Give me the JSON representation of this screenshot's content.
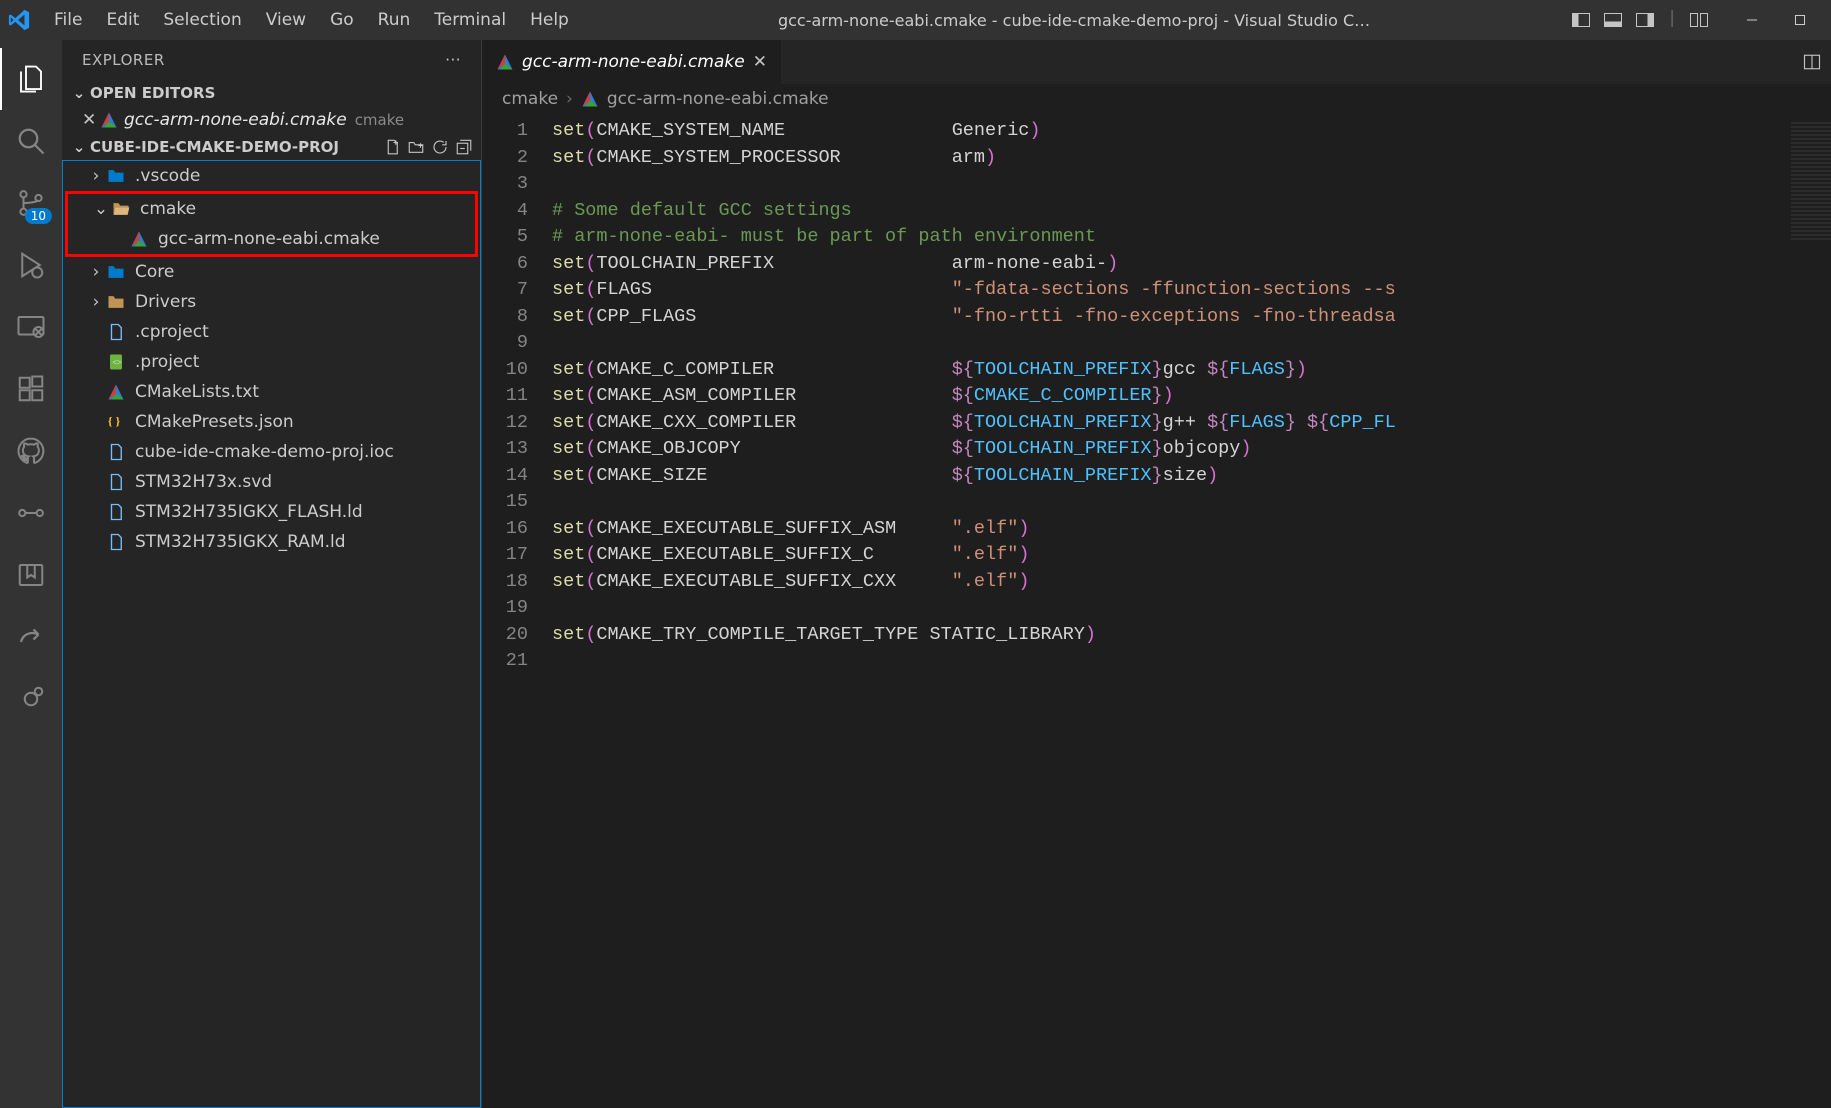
{
  "menu": [
    "File",
    "Edit",
    "Selection",
    "View",
    "Go",
    "Run",
    "Terminal",
    "Help"
  ],
  "window_title": "gcc-arm-none-eabi.cmake - cube-ide-cmake-demo-proj - Visual Studio C…",
  "activity_badge_source_control": "10",
  "explorer": {
    "title": "EXPLORER",
    "open_editors_label": "OPEN EDITORS",
    "open_editor": {
      "name": "gcc-arm-none-eabi.cmake",
      "dir": "cmake"
    },
    "project_label": "CUBE-IDE-CMAKE-DEMO-PROJ",
    "tree": [
      {
        "type": "folder",
        "name": ".vscode",
        "depth": 1,
        "expanded": false,
        "icon": "vscode"
      },
      {
        "type": "folder",
        "name": "cmake",
        "depth": 1,
        "expanded": true,
        "icon": "folder",
        "highlight": true
      },
      {
        "type": "file",
        "name": "gcc-arm-none-eabi.cmake",
        "depth": 2,
        "icon": "cmake",
        "highlight": true
      },
      {
        "type": "folder",
        "name": "Core",
        "depth": 1,
        "expanded": false,
        "icon": "vscode"
      },
      {
        "type": "folder",
        "name": "Drivers",
        "depth": 1,
        "expanded": false,
        "icon": "folder"
      },
      {
        "type": "file",
        "name": ".cproject",
        "depth": 1,
        "icon": "file"
      },
      {
        "type": "file",
        "name": ".project",
        "depth": 1,
        "icon": "xml"
      },
      {
        "type": "file",
        "name": "CMakeLists.txt",
        "depth": 1,
        "icon": "cmake"
      },
      {
        "type": "file",
        "name": "CMakePresets.json",
        "depth": 1,
        "icon": "json"
      },
      {
        "type": "file",
        "name": "cube-ide-cmake-demo-proj.ioc",
        "depth": 1,
        "icon": "file"
      },
      {
        "type": "file",
        "name": "STM32H73x.svd",
        "depth": 1,
        "icon": "file"
      },
      {
        "type": "file",
        "name": "STM32H735IGKX_FLASH.ld",
        "depth": 1,
        "icon": "file"
      },
      {
        "type": "file",
        "name": "STM32H735IGKX_RAM.ld",
        "depth": 1,
        "icon": "file"
      }
    ]
  },
  "tab": {
    "name": "gcc-arm-none-eabi.cmake"
  },
  "breadcrumb": {
    "part1": "cmake",
    "part2": "gcc-arm-none-eabi.cmake"
  },
  "code_lines": [
    [
      [
        "fn",
        "set"
      ],
      [
        "paren",
        "("
      ],
      [
        "id",
        "CMAKE_SYSTEM_NAME               "
      ],
      [
        "id",
        "Generic"
      ],
      [
        "paren",
        ")"
      ]
    ],
    [
      [
        "fn",
        "set"
      ],
      [
        "paren",
        "("
      ],
      [
        "id",
        "CMAKE_SYSTEM_PROCESSOR          "
      ],
      [
        "id",
        "arm"
      ],
      [
        "paren",
        ")"
      ]
    ],
    [],
    [
      [
        "cmt",
        "# Some default GCC settings"
      ]
    ],
    [
      [
        "cmt",
        "# arm-none-eabi- must be part of path environment"
      ]
    ],
    [
      [
        "fn",
        "set"
      ],
      [
        "paren",
        "("
      ],
      [
        "id",
        "TOOLCHAIN_PREFIX                "
      ],
      [
        "id",
        "arm-none-eabi-"
      ],
      [
        "paren",
        ")"
      ]
    ],
    [
      [
        "fn",
        "set"
      ],
      [
        "paren",
        "("
      ],
      [
        "id",
        "FLAGS                           "
      ],
      [
        "str",
        "\"-fdata-sections -ffunction-sections --s"
      ]
    ],
    [
      [
        "fn",
        "set"
      ],
      [
        "paren",
        "("
      ],
      [
        "id",
        "CPP_FLAGS                       "
      ],
      [
        "str",
        "\"-fno-rtti -fno-exceptions -fno-threadsa"
      ]
    ],
    [],
    [
      [
        "fn",
        "set"
      ],
      [
        "paren",
        "("
      ],
      [
        "id",
        "CMAKE_C_COMPILER                "
      ],
      [
        "macro",
        "${"
      ],
      [
        "const",
        "TOOLCHAIN_PREFIX"
      ],
      [
        "macro",
        "}"
      ],
      [
        "id",
        "gcc "
      ],
      [
        "macro",
        "${"
      ],
      [
        "const",
        "FLAGS"
      ],
      [
        "macro",
        "}"
      ],
      [
        "paren",
        ")"
      ]
    ],
    [
      [
        "fn",
        "set"
      ],
      [
        "paren",
        "("
      ],
      [
        "id",
        "CMAKE_ASM_COMPILER              "
      ],
      [
        "macro",
        "${"
      ],
      [
        "const",
        "CMAKE_C_COMPILER"
      ],
      [
        "macro",
        "}"
      ],
      [
        "paren",
        ")"
      ]
    ],
    [
      [
        "fn",
        "set"
      ],
      [
        "paren",
        "("
      ],
      [
        "id",
        "CMAKE_CXX_COMPILER              "
      ],
      [
        "macro",
        "${"
      ],
      [
        "const",
        "TOOLCHAIN_PREFIX"
      ],
      [
        "macro",
        "}"
      ],
      [
        "id",
        "g++ "
      ],
      [
        "macro",
        "${"
      ],
      [
        "const",
        "FLAGS"
      ],
      [
        "macro",
        "}"
      ],
      [
        "id",
        " "
      ],
      [
        "macro",
        "${"
      ],
      [
        "const",
        "CPP_FL"
      ]
    ],
    [
      [
        "fn",
        "set"
      ],
      [
        "paren",
        "("
      ],
      [
        "id",
        "CMAKE_OBJCOPY                   "
      ],
      [
        "macro",
        "${"
      ],
      [
        "const",
        "TOOLCHAIN_PREFIX"
      ],
      [
        "macro",
        "}"
      ],
      [
        "id",
        "objcopy"
      ],
      [
        "paren",
        ")"
      ]
    ],
    [
      [
        "fn",
        "set"
      ],
      [
        "paren",
        "("
      ],
      [
        "id",
        "CMAKE_SIZE                      "
      ],
      [
        "macro",
        "${"
      ],
      [
        "const",
        "TOOLCHAIN_PREFIX"
      ],
      [
        "macro",
        "}"
      ],
      [
        "id",
        "size"
      ],
      [
        "paren",
        ")"
      ]
    ],
    [],
    [
      [
        "fn",
        "set"
      ],
      [
        "paren",
        "("
      ],
      [
        "id",
        "CMAKE_EXECUTABLE_SUFFIX_ASM     "
      ],
      [
        "str",
        "\".elf\""
      ],
      [
        "paren",
        ")"
      ]
    ],
    [
      [
        "fn",
        "set"
      ],
      [
        "paren",
        "("
      ],
      [
        "id",
        "CMAKE_EXECUTABLE_SUFFIX_C       "
      ],
      [
        "str",
        "\".elf\""
      ],
      [
        "paren",
        ")"
      ]
    ],
    [
      [
        "fn",
        "set"
      ],
      [
        "paren",
        "("
      ],
      [
        "id",
        "CMAKE_EXECUTABLE_SUFFIX_CXX     "
      ],
      [
        "str",
        "\".elf\""
      ],
      [
        "paren",
        ")"
      ]
    ],
    [],
    [
      [
        "fn",
        "set"
      ],
      [
        "paren",
        "("
      ],
      [
        "id",
        "CMAKE_TRY_COMPILE_TARGET_TYPE "
      ],
      [
        "id",
        "STATIC_LIBRARY"
      ],
      [
        "paren",
        ")"
      ]
    ],
    []
  ]
}
